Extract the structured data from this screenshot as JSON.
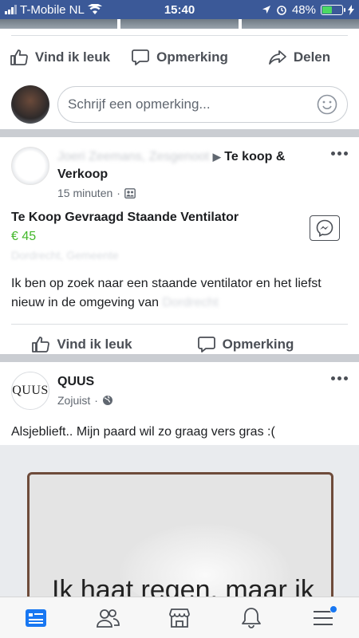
{
  "status_bar": {
    "carrier": "T-Mobile NL",
    "time": "15:40",
    "battery_percent_text": "48%",
    "battery_level": 0.48
  },
  "post1": {
    "like_label": "Vind ik leuk",
    "comment_label": "Opmerking",
    "share_label": "Delen",
    "comment_placeholder": "Schrijf een opmerking..."
  },
  "post2": {
    "name_blurred": "Joeri Zeemans, Zesgenoot",
    "arrow": "▶",
    "group": "Te koop &",
    "group2": "Verkoop",
    "time": "15 minuten",
    "listing_title": "Te Koop Gevraagd Staande Ventilator",
    "price": "€ 45",
    "location_blurred": "Dordrecht, Gemeente",
    "body": "Ik ben op zoek naar een staande ventilator en het liefst nieuw in de omgeving van",
    "body_blurred": "Dordrecht",
    "like_label": "Vind ik leuk",
    "comment_label": "Opmerking"
  },
  "post3": {
    "avatar_text": "QUUS",
    "name": "QUUS",
    "time": "Zojuist",
    "body": "Alsjeblieft.. Mijn paard wil zo graag vers gras :(",
    "image_text": "Ik haat regen, maar ik"
  },
  "colors": {
    "brand": "#3b5998",
    "price": "#42b72a",
    "nav_active": "#1877f2"
  },
  "icons": [
    "wifi-icon",
    "location-arrow-icon",
    "alarm-icon",
    "charging-icon",
    "like-icon",
    "comment-icon",
    "share-icon",
    "smiley-icon",
    "more-icon",
    "friends-icon",
    "globe-icon",
    "messenger-icon",
    "news-feed-icon",
    "friends-nav-icon",
    "marketplace-icon",
    "notifications-icon",
    "menu-icon"
  ]
}
